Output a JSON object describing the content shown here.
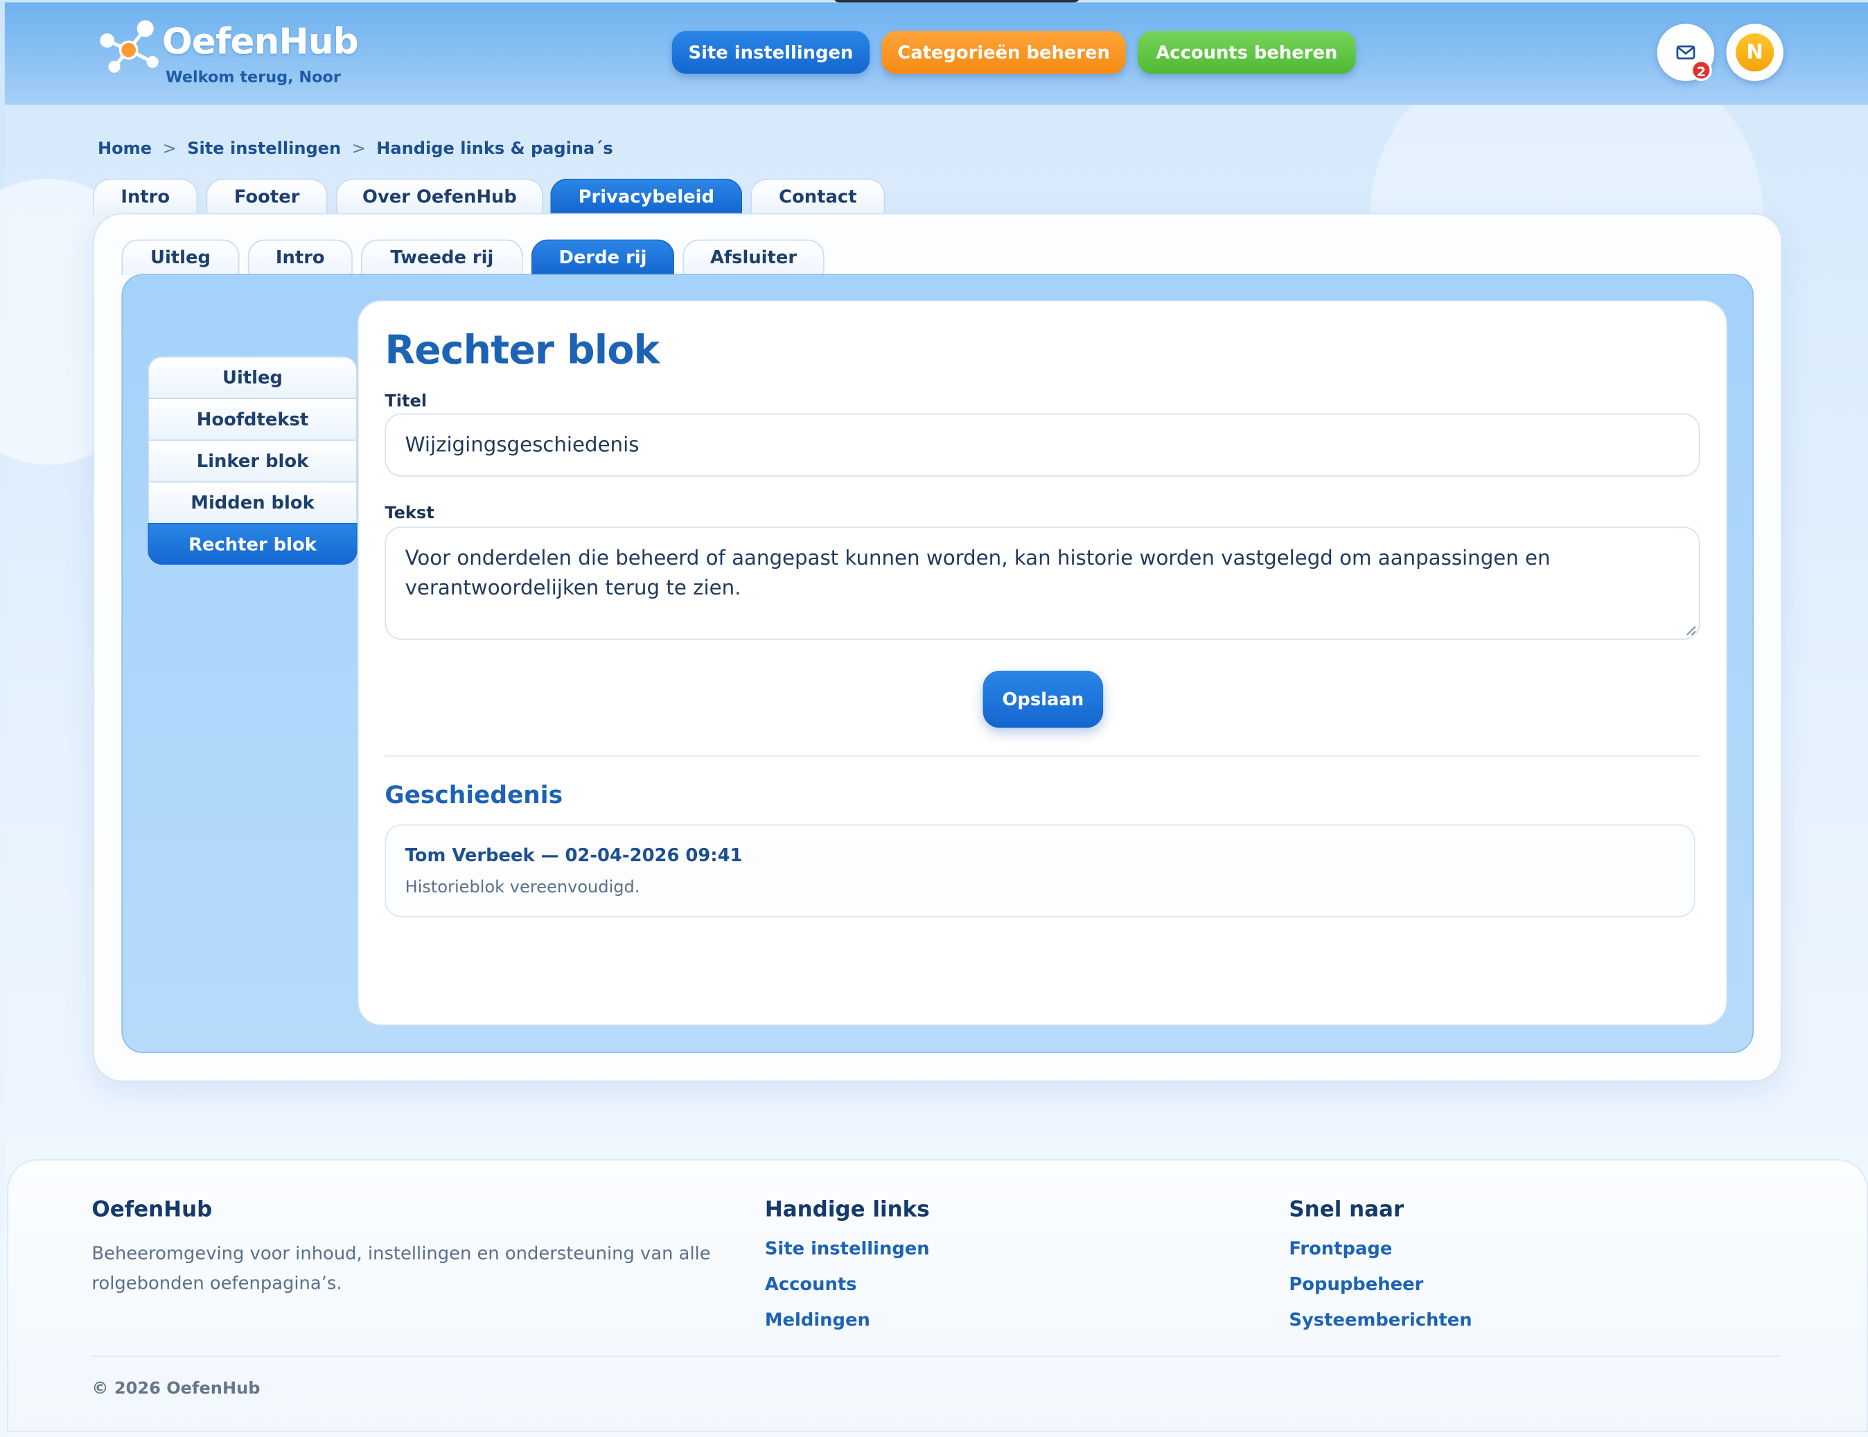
{
  "header": {
    "brand": "OefenHub",
    "welcome": "Welkom terug, Noor",
    "buttons": {
      "site_settings": "Site instellingen",
      "categories": "Categorieën beheren",
      "accounts": "Accounts beheren"
    },
    "mail_badge": "2",
    "avatar_initial": "N",
    "colors": {
      "blue": "#1466cf",
      "orange": "#f58a12",
      "green": "#4fb934"
    }
  },
  "breadcrumb": {
    "items": [
      "Home",
      "Site instellingen",
      "Handige links & pagina´s"
    ],
    "separator": ">"
  },
  "main_tabs": {
    "items": [
      "Intro",
      "Footer",
      "Over OefenHub",
      "Privacybeleid",
      "Contact"
    ],
    "active": "Privacybeleid"
  },
  "sub_tabs": {
    "items": [
      "Uitleg",
      "Intro",
      "Tweede rij",
      "Derde rij",
      "Afsluiter"
    ],
    "active": "Derde rij"
  },
  "side_menu": {
    "items": [
      "Uitleg",
      "Hoofdtekst",
      "Linker blok",
      "Midden blok",
      "Rechter blok"
    ],
    "active": "Rechter blok"
  },
  "editor": {
    "heading": "Rechter blok",
    "title_label": "Titel",
    "title_value": "Wijzigingsgeschiedenis",
    "text_label": "Tekst",
    "text_value": "Voor onderdelen die beheerd of aangepast kunnen worden, kan historie worden vastgelegd om aanpassingen en verantwoordelijken terug te zien.",
    "save_label": "Opslaan"
  },
  "history": {
    "heading": "Geschiedenis",
    "entries": [
      {
        "header": "Tom Verbeek — 02-04-2026 09:41",
        "body": "Historieblok vereenvoudigd."
      }
    ]
  },
  "footer": {
    "about_title": "OefenHub",
    "about_text": "Beheeromgeving voor inhoud, instellingen en ondersteuning van alle rolgebonden oefenpagina’s.",
    "links_title": "Handige links",
    "links": [
      "Site instellingen",
      "Accounts",
      "Meldingen"
    ],
    "quick_title": "Snel naar",
    "quick": [
      "Frontpage",
      "Popupbeheer",
      "Systeemberichten"
    ],
    "copyright": "© 2026 OefenHub"
  }
}
